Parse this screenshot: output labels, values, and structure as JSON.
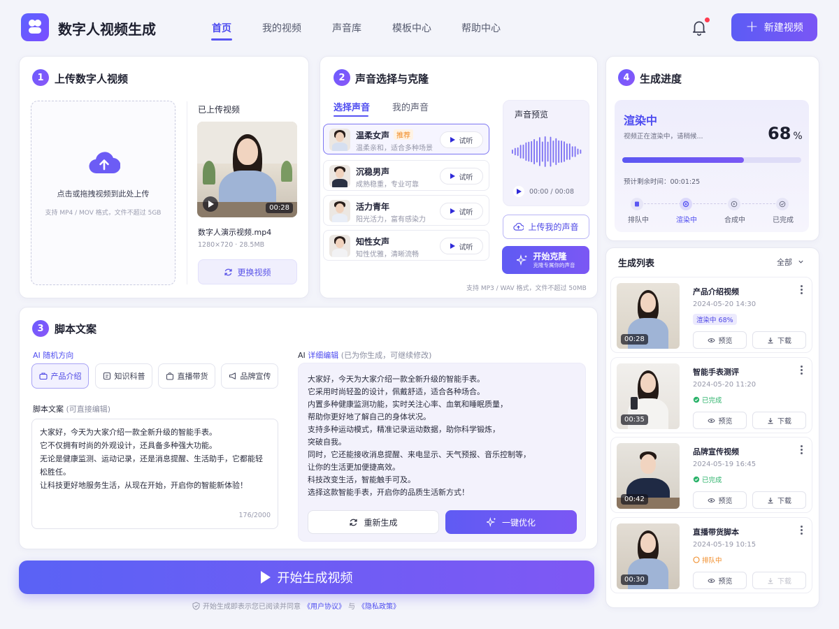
{
  "header": {
    "app_title": "数字人视频生成",
    "nav": [
      "首页",
      "我的视频",
      "声音库",
      "模板中心",
      "帮助中心"
    ],
    "new_button": "新建视频"
  },
  "upload": {
    "num": "1",
    "title": "上传数字人视频",
    "drop_text": "点击或拖拽视频到此处上传",
    "drop_hint": "支持 MP4 / MOV 格式，文件不超过 5GB",
    "uploaded_label": "已上传视频",
    "duration": "00:28",
    "file_name": "数字人演示视频.mp4",
    "file_meta": "1280×720 · 28.5MB",
    "replace_button": "更换视频"
  },
  "voice": {
    "num": "2",
    "title": "声音选择与克隆",
    "tabs": [
      "选择声音",
      "我的声音"
    ],
    "recommend_badge": "推荐",
    "listen_label": "试听",
    "items": [
      {
        "name": "温柔女声",
        "desc": "温柔亲和，适合多种场景"
      },
      {
        "name": "沉稳男声",
        "desc": "成熟稳重，专业可靠"
      },
      {
        "name": "活力青年",
        "desc": "阳光活力，富有感染力"
      },
      {
        "name": "知性女声",
        "desc": "知性优雅，清晰流畅"
      }
    ],
    "preview_label": "声音预览",
    "preview_time": "00:00 / 00:08",
    "upload_voice": "上传我的声音",
    "clone_button": "开始克隆",
    "clone_sub": "克隆专属你的声音",
    "format_hint": "支持 MP3 / WAV 格式，文件不超过 50MB"
  },
  "script": {
    "num": "3",
    "title": "脚本文案",
    "ai_random_label": "AI 随机方向",
    "chips": [
      "产品介绍",
      "知识科普",
      "直播带货",
      "品牌宣传"
    ],
    "script_label": "脚本文案",
    "script_label_hint": "(可直接编辑)",
    "script_text": [
      "大家好，今天为大家介绍一款全新升级的智能手表。",
      "它不仅拥有时尚的外观设计，还具备多种强大功能。",
      "无论是健康监测、运动记录，还是消息提醒、生活助手，它都能轻松胜任。",
      "让科技更好地服务生活，从现在开始，开启你的智能新体验！"
    ],
    "char_count": "176/2000",
    "ai_edit_prefix": "AI",
    "ai_edit_label": "详细编辑",
    "ai_edit_hint": "(已为你生成，可继续修改)",
    "ai_text": [
      "大家好，今天为大家介绍一款全新升级的智能手表。",
      "它采用时尚轻盈的设计，佩戴舒适，适合各种场合。",
      "内置多种健康监测功能，实时关注心率、血氧和睡眠质量，",
      "帮助你更好地了解自己的身体状况。",
      "支持多种运动模式，精准记录运动数据，助你科学锻炼，",
      "突破自我。",
      "同时，它还能接收消息提醒、来电显示、天气预报、音乐控制等，",
      "让你的生活更加便捷高效。",
      "科技改变生活，智能触手可及。",
      "选择这款智能手表，开启你的品质生活新方式！"
    ],
    "regenerate": "重新生成",
    "optimize": "一键优化"
  },
  "generate": {
    "button": "开始生成视频",
    "agreement_prefix": "开始生成即表示您已阅读并同意",
    "user_agreement": "《用户协议》",
    "and": "与",
    "privacy": "《隐私政策》"
  },
  "progress": {
    "num": "4",
    "title": "生成进度",
    "status": "渲染中",
    "status_desc": "视频正在渲染中，请稍候...",
    "percent": "68",
    "percent_unit": "%",
    "percent_value": 0.68,
    "remaining": "预计剩余时间：00:01:25",
    "steps": [
      "排队中",
      "渲染中",
      "合成中",
      "已完成"
    ]
  },
  "gen_list": {
    "title": "生成列表",
    "filter": "全部",
    "preview_label": "预览",
    "download_label": "下载",
    "items": [
      {
        "name": "产品介绍视频",
        "date": "2024-05-20 14:30",
        "status": "渲染中 68%",
        "duration": "00:28"
      },
      {
        "name": "智能手表测评",
        "date": "2024-05-20 11:20",
        "status": "已完成",
        "duration": "00:35"
      },
      {
        "name": "品牌宣传视频",
        "date": "2024-05-19 16:45",
        "status": "已完成",
        "duration": "00:42"
      },
      {
        "name": "直播带货脚本",
        "date": "2024-05-19 10:15",
        "status": "排队中",
        "duration": "00:30"
      }
    ]
  },
  "colors": {
    "accent": "#5b57f2",
    "rendering": "#4f49e6",
    "done": "#2cb36b",
    "queued": "#f08a24"
  }
}
